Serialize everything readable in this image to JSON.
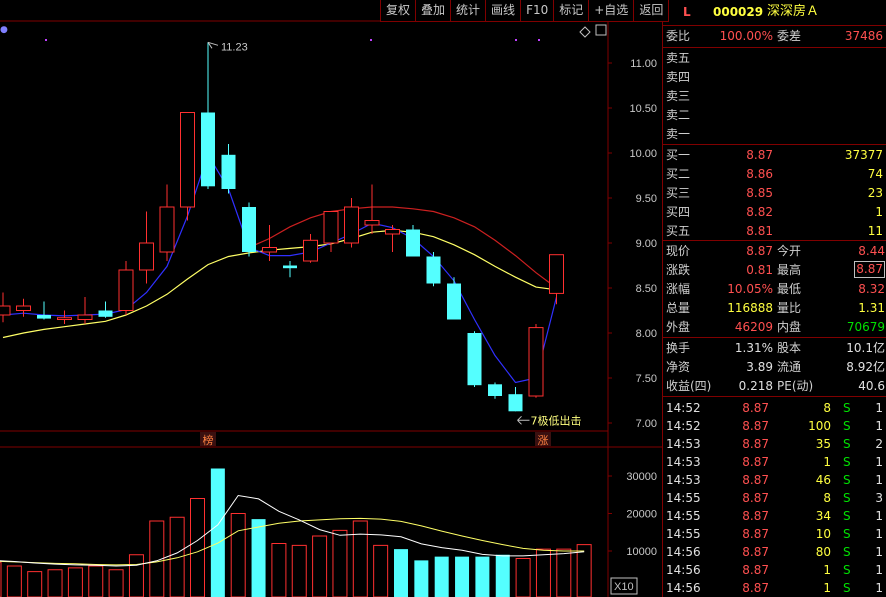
{
  "toolbar": {
    "buttons": [
      "复权",
      "叠加",
      "统计",
      "画线",
      "F10",
      "标记",
      "+自选",
      "返回"
    ]
  },
  "stock": {
    "flag": "L",
    "code": "000029",
    "name": "深深房Ａ"
  },
  "weibi": {
    "label": "委比",
    "value": "100.00%",
    "diff_label": "委差",
    "diff_value": "37486"
  },
  "sell": [
    {
      "label": "卖五",
      "price": "",
      "vol": ""
    },
    {
      "label": "卖四",
      "price": "",
      "vol": ""
    },
    {
      "label": "卖三",
      "price": "",
      "vol": ""
    },
    {
      "label": "卖二",
      "price": "",
      "vol": ""
    },
    {
      "label": "卖一",
      "price": "",
      "vol": ""
    }
  ],
  "buy": [
    {
      "label": "买一",
      "price": "8.87",
      "vol": "37377"
    },
    {
      "label": "买二",
      "price": "8.86",
      "vol": "74"
    },
    {
      "label": "买三",
      "price": "8.85",
      "vol": "23"
    },
    {
      "label": "买四",
      "price": "8.82",
      "vol": "1"
    },
    {
      "label": "买五",
      "price": "8.81",
      "vol": "11"
    }
  ],
  "quote": [
    {
      "l1": "现价",
      "v1": "8.87",
      "c1": "red",
      "l2": "今开",
      "v2": "8.44",
      "c2": "red"
    },
    {
      "l1": "涨跌",
      "v1": "0.81",
      "c1": "red",
      "l2": "最高",
      "v2": "8.87",
      "c2": "red",
      "box2": true
    },
    {
      "l1": "涨幅",
      "v1": "10.05%",
      "c1": "red",
      "l2": "最低",
      "v2": "8.32",
      "c2": "red"
    },
    {
      "l1": "总量",
      "v1": "116888",
      "c1": "yellow",
      "l2": "量比",
      "v2": "1.31",
      "c2": "yellow"
    },
    {
      "l1": "外盘",
      "v1": "46209",
      "c1": "red",
      "l2": "内盘",
      "v2": "70679",
      "c2": "green"
    }
  ],
  "fundamentals": [
    {
      "l1": "换手",
      "v1": "1.31%",
      "l2": "股本",
      "v2": "10.1亿"
    },
    {
      "l1": "净资",
      "v1": "3.89",
      "l2": "流通",
      "v2": "8.92亿"
    },
    {
      "l1": "收益(四)",
      "v1": "0.218",
      "l2": "PE(动)",
      "v2": "40.6"
    }
  ],
  "ticks": [
    {
      "time": "14:52",
      "price": "8.87",
      "vol": "8",
      "side": "S",
      "n": "1"
    },
    {
      "time": "14:52",
      "price": "8.87",
      "vol": "100",
      "side": "S",
      "n": "1"
    },
    {
      "time": "14:53",
      "price": "8.87",
      "vol": "35",
      "side": "S",
      "n": "2"
    },
    {
      "time": "14:53",
      "price": "8.87",
      "vol": "1",
      "side": "S",
      "n": "1"
    },
    {
      "time": "14:53",
      "price": "8.87",
      "vol": "46",
      "side": "S",
      "n": "1"
    },
    {
      "time": "14:55",
      "price": "8.87",
      "vol": "8",
      "side": "S",
      "n": "3"
    },
    {
      "time": "14:55",
      "price": "8.87",
      "vol": "34",
      "side": "S",
      "n": "1"
    },
    {
      "time": "14:55",
      "price": "8.87",
      "vol": "10",
      "side": "S",
      "n": "1"
    },
    {
      "time": "14:56",
      "price": "8.87",
      "vol": "80",
      "side": "S",
      "n": "1"
    },
    {
      "time": "14:56",
      "price": "8.87",
      "vol": "1",
      "side": "S",
      "n": "1"
    },
    {
      "time": "14:56",
      "price": "8.87",
      "vol": "1",
      "side": "S",
      "n": "1"
    }
  ],
  "chart_data": {
    "type": "candlestick",
    "price_axis_ticks": [
      "11.00",
      "10.50",
      "10.00",
      "9.50",
      "9.00",
      "8.50",
      "8.00",
      "7.50",
      "7.00"
    ],
    "volume_axis_ticks": [
      "30000",
      "20000",
      "10000"
    ],
    "volume_unit_label": "X10",
    "high_annotation": "11.23",
    "low_annotation": "7极低出击",
    "badges": [
      "榜",
      "涨"
    ],
    "colors": {
      "up": "#ff3030",
      "down": "#54ffff",
      "ma_short": "#3030ff",
      "ma_long": "#ffff66",
      "ma_mid": "#cc2020",
      "ma_vol1": "#ffffff",
      "ma_vol2": "#ffff66"
    },
    "candles": [
      {
        "o": 8.2,
        "h": 8.45,
        "l": 8.12,
        "c": 8.3
      },
      {
        "o": 8.25,
        "h": 8.38,
        "l": 8.18,
        "c": 8.3
      },
      {
        "o": 8.2,
        "h": 8.35,
        "l": 8.15,
        "c": 8.16
      },
      {
        "o": 8.15,
        "h": 8.25,
        "l": 8.1,
        "c": 8.17
      },
      {
        "o": 8.15,
        "h": 8.4,
        "l": 8.1,
        "c": 8.2
      },
      {
        "o": 8.25,
        "h": 8.35,
        "l": 8.17,
        "c": 8.18
      },
      {
        "o": 8.25,
        "h": 8.8,
        "l": 8.2,
        "c": 8.7
      },
      {
        "o": 8.7,
        "h": 9.35,
        "l": 8.55,
        "c": 9.0
      },
      {
        "o": 8.9,
        "h": 9.65,
        "l": 8.8,
        "c": 9.4
      },
      {
        "o": 9.4,
        "h": 10.45,
        "l": 9.25,
        "c": 10.45
      },
      {
        "o": 10.45,
        "h": 11.23,
        "l": 9.6,
        "c": 9.63
      },
      {
        "o": 9.98,
        "h": 10.1,
        "l": 9.55,
        "c": 9.6
      },
      {
        "o": 9.4,
        "h": 9.45,
        "l": 8.85,
        "c": 8.9
      },
      {
        "o": 8.9,
        "h": 9.2,
        "l": 8.8,
        "c": 8.95
      },
      {
        "o": 8.75,
        "h": 8.8,
        "l": 8.62,
        "c": 8.72
      },
      {
        "o": 8.8,
        "h": 9.1,
        "l": 8.78,
        "c": 9.03
      },
      {
        "o": 9.0,
        "h": 9.35,
        "l": 8.9,
        "c": 9.35
      },
      {
        "o": 9.0,
        "h": 9.5,
        "l": 8.95,
        "c": 9.4
      },
      {
        "o": 9.2,
        "h": 9.65,
        "l": 9.1,
        "c": 9.25
      },
      {
        "o": 9.1,
        "h": 9.2,
        "l": 8.9,
        "c": 9.15
      },
      {
        "o": 9.15,
        "h": 9.2,
        "l": 8.85,
        "c": 8.85
      },
      {
        "o": 8.85,
        "h": 8.9,
        "l": 8.52,
        "c": 8.55
      },
      {
        "o": 8.55,
        "h": 8.62,
        "l": 8.15,
        "c": 8.15
      },
      {
        "o": 8.0,
        "h": 8.02,
        "l": 7.4,
        "c": 7.42
      },
      {
        "o": 7.43,
        "h": 7.45,
        "l": 7.27,
        "c": 7.3
      },
      {
        "o": 7.32,
        "h": 7.4,
        "l": 7.13,
        "c": 7.13
      },
      {
        "o": 7.3,
        "h": 8.1,
        "l": 7.28,
        "c": 8.06
      },
      {
        "o": 8.44,
        "h": 8.87,
        "l": 8.32,
        "c": 8.87
      }
    ],
    "ma_short": [
      8.2,
      8.22,
      8.2,
      8.19,
      8.2,
      8.21,
      8.26,
      8.45,
      8.74,
      9.3,
      9.98,
      9.6,
      8.95,
      8.86,
      8.86,
      8.9,
      9.0,
      9.1,
      9.22,
      9.17,
      9.05,
      8.85,
      8.58,
      8.15,
      7.75,
      7.45,
      7.5,
      8.4
    ],
    "ma_long": [
      7.95,
      8.0,
      8.04,
      8.07,
      8.1,
      8.13,
      8.2,
      8.3,
      8.43,
      8.6,
      8.76,
      8.85,
      8.89,
      8.92,
      8.94,
      8.96,
      8.99,
      9.05,
      9.12,
      9.14,
      9.12,
      9.07,
      8.98,
      8.87,
      8.74,
      8.62,
      8.51,
      8.48
    ],
    "ma_mid": [
      null,
      null,
      null,
      null,
      null,
      null,
      null,
      null,
      null,
      null,
      null,
      null,
      8.95,
      9.05,
      9.18,
      9.28,
      9.35,
      9.38,
      9.4,
      9.4,
      9.38,
      9.35,
      9.28,
      9.18,
      9.03,
      8.86,
      8.67,
      8.5
    ],
    "volumes": [
      7000,
      6000,
      4500,
      5000,
      5500,
      6000,
      5000,
      9000,
      18000,
      19000,
      24000,
      32000,
      20000,
      18500,
      12000,
      11500,
      14000,
      15500,
      18000,
      11500,
      10500,
      7500,
      8500,
      8500,
      8500,
      9000,
      8000,
      10500,
      10500,
      11700
    ],
    "vol_up": [
      true,
      true,
      true,
      true,
      true,
      true,
      true,
      true,
      true,
      true,
      true,
      false,
      true,
      false,
      true,
      true,
      true,
      true,
      true,
      true,
      false,
      false,
      false,
      false,
      false,
      false,
      true,
      true,
      true,
      true
    ],
    "vol_ma1": [
      7500,
      7200,
      6800,
      6500,
      6300,
      6200,
      6000,
      6200,
      7400,
      9500,
      12800,
      17000,
      24800,
      23900,
      20600,
      18300,
      15700,
      14200,
      14500,
      14300,
      13800,
      11900,
      10900,
      10200,
      9100,
      8700,
      8700,
      9000,
      9300,
      9800
    ],
    "vol_ma2": [
      7300,
      7100,
      6900,
      6700,
      6600,
      6400,
      6300,
      6400,
      7100,
      8200,
      9800,
      12100,
      15400,
      16400,
      17400,
      18000,
      18300,
      18600,
      18700,
      18500,
      17900,
      16700,
      15300,
      14000,
      12800,
      11700,
      10700,
      10200,
      10000,
      10000
    ]
  }
}
